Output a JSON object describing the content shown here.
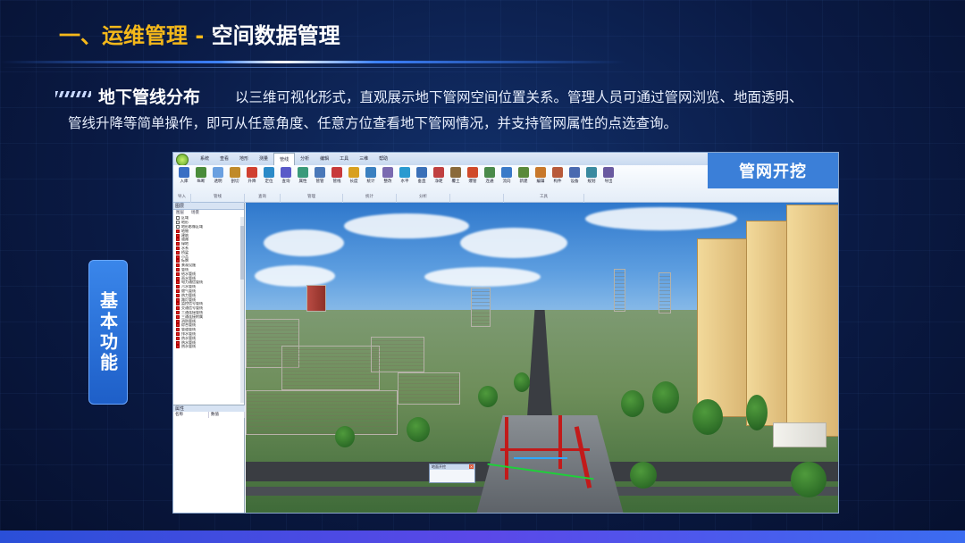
{
  "slide": {
    "title_part1": "一、运维管理 - ",
    "title_part2": "空间数据管理",
    "subheading": "地下管线分布",
    "description_line1": "以三维可视化形式，直观展示地下管网空间位置关系。管理人员可通过管网浏览、地面透明、",
    "description_line2": "管线升降等简单操作，即可从任意角度、任意方位查看地下管网情况，并支持管网属性的点选查询。",
    "side_label": "基本功能",
    "colors": {
      "accent": "#f5b81a",
      "background": "#0a1a44",
      "side_box": "#2f74dc",
      "badge": "#3b7fd8"
    }
  },
  "app": {
    "badge_label": "管网开挖",
    "menu": [
      "系统",
      "查看",
      "地形",
      "测量",
      "管线",
      "分析",
      "编辑",
      "工具",
      "三维",
      "帮助"
    ],
    "active_menu": "管线",
    "ribbon_buttons": [
      {
        "label": "入库",
        "icon": "database-icon",
        "color": "#3a6fc4"
      },
      {
        "label": "纵断",
        "icon": "profile-icon",
        "color": "#4a8c3a"
      },
      {
        "label": "透明",
        "icon": "transparent-icon",
        "color": "#6aa0e0"
      },
      {
        "label": "剖切",
        "icon": "section-icon",
        "color": "#c08a2a"
      },
      {
        "label": "升降",
        "icon": "lift-icon",
        "color": "#d04030"
      },
      {
        "label": "定位",
        "icon": "locate-icon",
        "color": "#2a8ac8"
      },
      {
        "label": "查询",
        "icon": "query-icon",
        "color": "#5a5ac8"
      },
      {
        "label": "属性",
        "icon": "attribute-icon",
        "color": "#3a9a7a"
      },
      {
        "label": "管管",
        "icon": "pipe-pipe-icon",
        "color": "#4a78b8"
      },
      {
        "label": "管线",
        "icon": "pipeline-icon",
        "color": "#c83a3a"
      },
      {
        "label": "长度",
        "icon": "length-icon",
        "color": "#d8a020"
      },
      {
        "label": "统计",
        "icon": "stats-icon",
        "color": "#3a80c0"
      },
      {
        "label": "整改",
        "icon": "fix-icon",
        "color": "#7a6ab0"
      },
      {
        "label": "水平",
        "icon": "horizontal-icon",
        "color": "#2a9ad0"
      },
      {
        "label": "垂直",
        "icon": "vertical-icon",
        "color": "#3a70b8"
      },
      {
        "label": "净距",
        "icon": "clearance-icon",
        "color": "#c04040"
      },
      {
        "label": "覆土",
        "icon": "cover-icon",
        "color": "#8a6a3a"
      },
      {
        "label": "爆管",
        "icon": "burst-icon",
        "color": "#d04a2a"
      },
      {
        "label": "连通",
        "icon": "connect-icon",
        "color": "#4a8a4a"
      },
      {
        "label": "流向",
        "icon": "flow-icon",
        "color": "#3a7ac8"
      },
      {
        "label": "新建",
        "icon": "new-icon",
        "color": "#5a8a3a"
      },
      {
        "label": "编辑",
        "icon": "edit-icon",
        "color": "#c8782a"
      },
      {
        "label": "构件",
        "icon": "component-icon",
        "color": "#b85a3a"
      },
      {
        "label": "设备",
        "icon": "device-icon",
        "color": "#4a6ab0"
      },
      {
        "label": "规划",
        "icon": "plan-icon",
        "color": "#3a8aa0"
      },
      {
        "label": "导出",
        "icon": "export-icon",
        "color": "#6a5aa0"
      }
    ],
    "ribbon_groups": [
      "导入",
      "管线",
      "查询",
      "管理",
      "统计",
      "分析",
      "",
      "工具"
    ],
    "layer_panel": {
      "title": "图层",
      "tabs": [
        "图层",
        "场景"
      ],
      "items": [
        {
          "label": "区域",
          "checked": false
        },
        {
          "label": "地形",
          "checked": false
        },
        {
          "label": "地形影像区域",
          "checked": false
        },
        {
          "label": "地物",
          "checked": true
        },
        {
          "label": "建筑",
          "checked": true
        },
        {
          "label": "道路",
          "checked": true
        },
        {
          "label": "绿地",
          "checked": true
        },
        {
          "label": "水系",
          "checked": true
        },
        {
          "label": "桥梁",
          "checked": true
        },
        {
          "label": "小品",
          "checked": true
        },
        {
          "label": "标牌",
          "checked": true
        },
        {
          "label": "景观设施",
          "checked": true
        },
        {
          "label": "管线",
          "checked": true
        },
        {
          "label": "给水管线",
          "checked": true
        },
        {
          "label": "雨水管线",
          "checked": true
        },
        {
          "label": "电力通信管线",
          "checked": true
        },
        {
          "label": "污水管线",
          "checked": true
        },
        {
          "label": "燃气管线",
          "checked": true
        },
        {
          "label": "热力管线",
          "checked": true
        },
        {
          "label": "路灯管线",
          "checked": true
        },
        {
          "label": "监控信号管线",
          "checked": true
        },
        {
          "label": "交通信号管线",
          "checked": true
        },
        {
          "label": "三通连接管线",
          "checked": true
        },
        {
          "label": "三通连接附属",
          "checked": true
        },
        {
          "label": "消防管线",
          "checked": true
        },
        {
          "label": "综合管线",
          "checked": true
        },
        {
          "label": "管道管线",
          "checked": true
        },
        {
          "label": "排水管线",
          "checked": true
        },
        {
          "label": "热水管线",
          "checked": true
        },
        {
          "label": "热水管线",
          "checked": true
        },
        {
          "label": "热水管线",
          "checked": true
        }
      ]
    },
    "property_panel": {
      "title": "属性",
      "col1": "名称",
      "col2": "数值"
    },
    "dialog_title": "地面开挖"
  }
}
